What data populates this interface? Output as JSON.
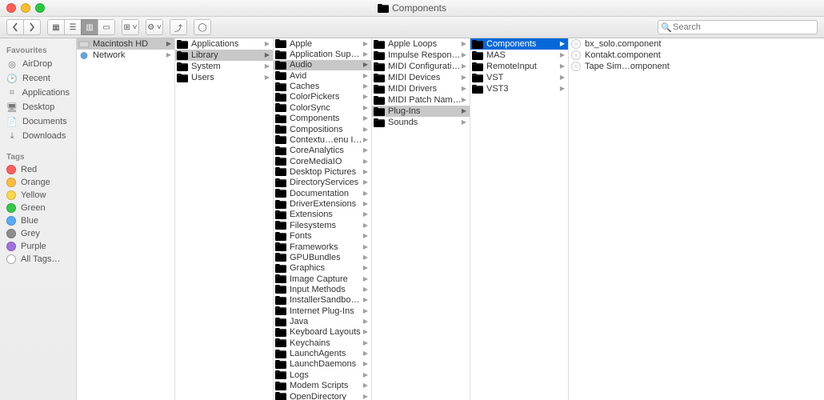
{
  "window": {
    "title": "Components"
  },
  "search": {
    "placeholder": "Search"
  },
  "sidebar": {
    "favourites_header": "Favourites",
    "favourites": [
      {
        "label": "AirDrop",
        "icon": "airdrop"
      },
      {
        "label": "Recent",
        "icon": "clock"
      },
      {
        "label": "Applications",
        "icon": "apps"
      },
      {
        "label": "Desktop",
        "icon": "desktop"
      },
      {
        "label": "Documents",
        "icon": "docs"
      },
      {
        "label": "Downloads",
        "icon": "downloads"
      }
    ],
    "tags_header": "Tags",
    "tags": [
      {
        "label": "Red",
        "color": "#fc605c"
      },
      {
        "label": "Orange",
        "color": "#fdbc40"
      },
      {
        "label": "Yellow",
        "color": "#fcd84a"
      },
      {
        "label": "Green",
        "color": "#34c84a"
      },
      {
        "label": "Blue",
        "color": "#57acf5"
      },
      {
        "label": "Grey",
        "color": "#8e8e8e"
      },
      {
        "label": "Purple",
        "color": "#a070e0"
      }
    ],
    "all_tags": "All Tags…"
  },
  "columns": [
    {
      "items": [
        {
          "label": "Macintosh HD",
          "icon": "hd",
          "arrow": true,
          "sel": "sel"
        },
        {
          "label": "Network",
          "icon": "net",
          "arrow": true
        }
      ]
    },
    {
      "items": [
        {
          "label": "Applications",
          "icon": "folder",
          "arrow": true
        },
        {
          "label": "Library",
          "icon": "folder",
          "arrow": true,
          "sel": "sel"
        },
        {
          "label": "System",
          "icon": "folder",
          "arrow": true
        },
        {
          "label": "Users",
          "icon": "folder",
          "arrow": true
        }
      ]
    },
    {
      "items": [
        {
          "label": "Apple",
          "icon": "folder",
          "arrow": true
        },
        {
          "label": "Application Support",
          "icon": "folder",
          "arrow": true
        },
        {
          "label": "Audio",
          "icon": "folder",
          "arrow": true,
          "sel": "sel"
        },
        {
          "label": "Avid",
          "icon": "folder",
          "arrow": true
        },
        {
          "label": "Caches",
          "icon": "folder",
          "arrow": true
        },
        {
          "label": "ColorPickers",
          "icon": "folder",
          "arrow": true
        },
        {
          "label": "ColorSync",
          "icon": "folder",
          "arrow": true
        },
        {
          "label": "Components",
          "icon": "folder",
          "arrow": true
        },
        {
          "label": "Compositions",
          "icon": "folder",
          "arrow": true
        },
        {
          "label": "Contextu…enu Items",
          "icon": "folder",
          "arrow": true
        },
        {
          "label": "CoreAnalytics",
          "icon": "folder",
          "arrow": true
        },
        {
          "label": "CoreMediaIO",
          "icon": "folder",
          "arrow": true
        },
        {
          "label": "Desktop Pictures",
          "icon": "folder",
          "arrow": true
        },
        {
          "label": "DirectoryServices",
          "icon": "folder",
          "arrow": true
        },
        {
          "label": "Documentation",
          "icon": "folder",
          "arrow": true
        },
        {
          "label": "DriverExtensions",
          "icon": "folder",
          "arrow": true
        },
        {
          "label": "Extensions",
          "icon": "folder",
          "arrow": true
        },
        {
          "label": "Filesystems",
          "icon": "folder",
          "arrow": true
        },
        {
          "label": "Fonts",
          "icon": "folder",
          "arrow": true
        },
        {
          "label": "Frameworks",
          "icon": "folder",
          "arrow": true
        },
        {
          "label": "GPUBundles",
          "icon": "folder",
          "arrow": true
        },
        {
          "label": "Graphics",
          "icon": "folder",
          "arrow": true
        },
        {
          "label": "Image Capture",
          "icon": "folder",
          "arrow": true
        },
        {
          "label": "Input Methods",
          "icon": "folder",
          "arrow": true
        },
        {
          "label": "InstallerSandboxes",
          "icon": "folder",
          "arrow": true
        },
        {
          "label": "Internet Plug-Ins",
          "icon": "folder",
          "arrow": true
        },
        {
          "label": "Java",
          "icon": "folder",
          "arrow": true
        },
        {
          "label": "Keyboard Layouts",
          "icon": "folder",
          "arrow": true
        },
        {
          "label": "Keychains",
          "icon": "folder",
          "arrow": true
        },
        {
          "label": "LaunchAgents",
          "icon": "folder",
          "arrow": true
        },
        {
          "label": "LaunchDaemons",
          "icon": "folder",
          "arrow": true
        },
        {
          "label": "Logs",
          "icon": "folder",
          "arrow": true
        },
        {
          "label": "Modem Scripts",
          "icon": "folder",
          "arrow": true
        },
        {
          "label": "OpenDirectory",
          "icon": "folder",
          "arrow": true
        }
      ]
    },
    {
      "items": [
        {
          "label": "Apple Loops",
          "icon": "folder",
          "arrow": true
        },
        {
          "label": "Impulse Responses",
          "icon": "folder",
          "arrow": true
        },
        {
          "label": "MIDI Configurations",
          "icon": "folder",
          "arrow": true
        },
        {
          "label": "MIDI Devices",
          "icon": "folder",
          "arrow": true
        },
        {
          "label": "MIDI Drivers",
          "icon": "folder",
          "arrow": true
        },
        {
          "label": "MIDI Patch Names",
          "icon": "folder",
          "arrow": true
        },
        {
          "label": "Plug-Ins",
          "icon": "folder",
          "arrow": true,
          "sel": "sel"
        },
        {
          "label": "Sounds",
          "icon": "folder",
          "arrow": true
        }
      ]
    },
    {
      "items": [
        {
          "label": "Components",
          "icon": "folder",
          "arrow": true,
          "sel": "hl"
        },
        {
          "label": "MAS",
          "icon": "folder",
          "arrow": true
        },
        {
          "label": "RemoteInput",
          "icon": "folder",
          "arrow": true
        },
        {
          "label": "VST",
          "icon": "folder",
          "arrow": true
        },
        {
          "label": "VST3",
          "icon": "folder",
          "arrow": true
        }
      ]
    },
    {
      "items": [
        {
          "label": "bx_solo.component",
          "icon": "plugin"
        },
        {
          "label": "Kontakt.component",
          "icon": "plugin"
        },
        {
          "label": "Tape Sim…omponent",
          "icon": "plugin"
        }
      ]
    }
  ]
}
